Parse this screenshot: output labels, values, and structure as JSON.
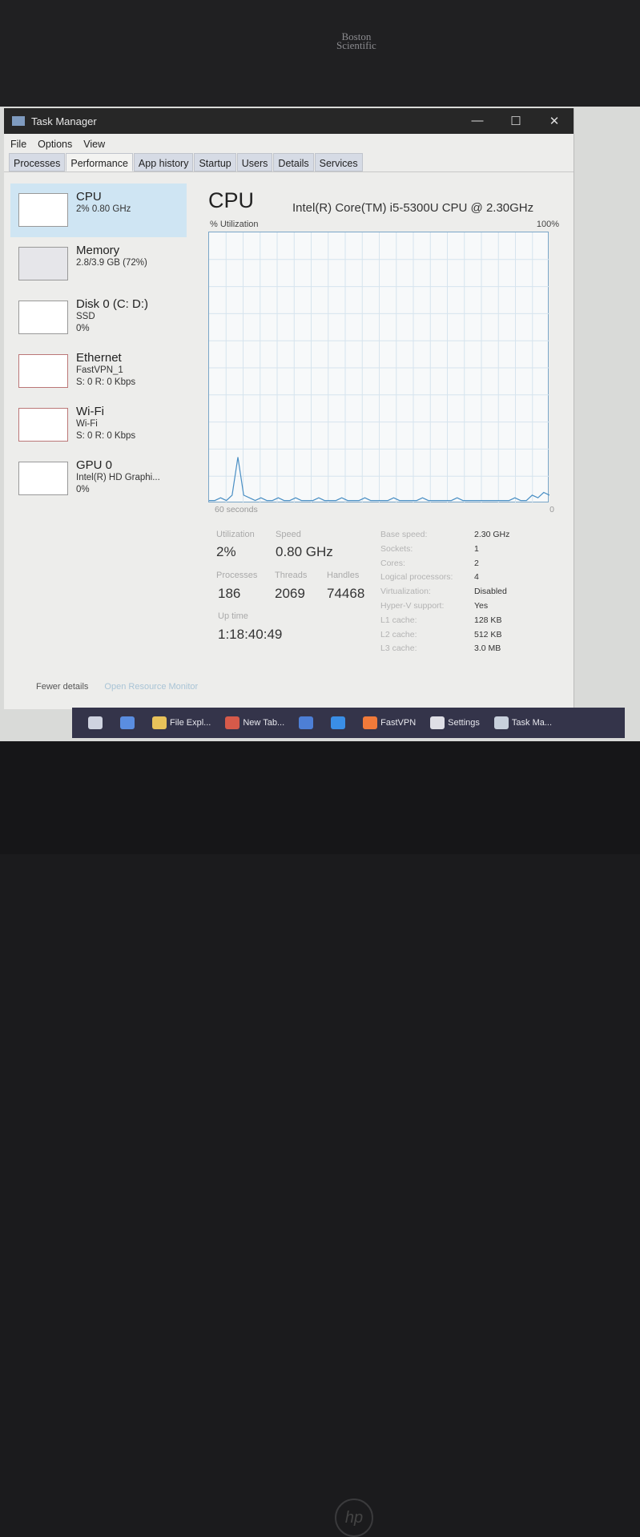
{
  "bezel": {
    "brand": "Boston Scientific",
    "logo": "hp"
  },
  "window": {
    "title": "Task Manager",
    "controls": [
      "minimize",
      "maximize",
      "close"
    ]
  },
  "menu": [
    "File",
    "Options",
    "View"
  ],
  "tabs": [
    "Processes",
    "Performance",
    "App history",
    "Startup",
    "Users",
    "Details",
    "Services"
  ],
  "active_tab": "Performance",
  "sidebar": [
    {
      "name": "CPU",
      "l1": "2% 0.80 GHz",
      "l2": "",
      "selected": true
    },
    {
      "name": "Memory",
      "l1": "2.8/3.9 GB (72%)",
      "l2": ""
    },
    {
      "name": "Disk 0 (C: D:)",
      "l1": "SSD",
      "l2": "0%"
    },
    {
      "name": "Ethernet",
      "l1": "FastVPN_1",
      "l2": "S: 0 R: 0 Kbps"
    },
    {
      "name": "Wi-Fi",
      "l1": "Wi-Fi",
      "l2": "S: 0 R: 0 Kbps"
    },
    {
      "name": "GPU 0",
      "l1": "Intel(R) HD Graphi...",
      "l2": "0%"
    }
  ],
  "main": {
    "title": "CPU",
    "model": "Intel(R) Core(TM) i5-5300U CPU @ 2.30GHz",
    "y_label": "% Utilization",
    "y_max": "100%",
    "x_label": "60 seconds",
    "y_min": "0",
    "utilization_samples": [
      1,
      1,
      2,
      1,
      3,
      17,
      3,
      2,
      1,
      2,
      1,
      1,
      2,
      1,
      1,
      2,
      1,
      1,
      1,
      2,
      1,
      1,
      1,
      2,
      1,
      1,
      1,
      2,
      1,
      1,
      1,
      1,
      2,
      1,
      1,
      1,
      1,
      2,
      1,
      1,
      1,
      1,
      1,
      2,
      1,
      1,
      1,
      1,
      1,
      1,
      1,
      1,
      1,
      2,
      1,
      1,
      3,
      2,
      4,
      3
    ],
    "stats": {
      "utilization_label": "Utilization",
      "utilization": "2%",
      "speed_label": "Speed",
      "speed": "0.80 GHz",
      "processes_label": "Processes",
      "processes": "186",
      "threads_label": "Threads",
      "threads": "2069",
      "handles_label": "Handles",
      "handles": "74468",
      "uptime_label": "Up time",
      "uptime": "1:18:40:49"
    },
    "specs": [
      {
        "k": "Base speed:",
        "v": "2.30 GHz"
      },
      {
        "k": "Sockets:",
        "v": "1"
      },
      {
        "k": "Cores:",
        "v": "2"
      },
      {
        "k": "Logical processors:",
        "v": "4"
      },
      {
        "k": "Virtualization:",
        "v": "Disabled"
      },
      {
        "k": "Hyper-V support:",
        "v": "Yes"
      },
      {
        "k": "L1 cache:",
        "v": "128 KB"
      },
      {
        "k": "L2 cache:",
        "v": "512 KB"
      },
      {
        "k": "L3 cache:",
        "v": "3.0 MB"
      }
    ]
  },
  "footer": {
    "fewer": "Fewer details",
    "monitor": "Open Resource Monitor"
  },
  "taskbar": [
    {
      "label": "",
      "icon": "task-view",
      "color": "#cfd3e0"
    },
    {
      "label": "",
      "icon": "copilot",
      "color": "#5a8de0"
    },
    {
      "label": "File Expl...",
      "icon": "folder",
      "color": "#e8c25a"
    },
    {
      "label": "New Tab...",
      "icon": "chrome",
      "color": "#d65a4a"
    },
    {
      "label": "",
      "icon": "app",
      "color": "#4d7fd6"
    },
    {
      "label": "",
      "icon": "zoom",
      "color": "#3a8ee6"
    },
    {
      "label": "FastVPN",
      "icon": "fastvpn",
      "color": "#f07a3a"
    },
    {
      "label": "Settings",
      "icon": "gear",
      "color": "#dfdfe6"
    },
    {
      "label": "Task Ma...",
      "icon": "task-manager",
      "color": "#c8d0dc"
    }
  ],
  "colors": {
    "graph_line": "#4a8fc4",
    "grid": "#d6e4ee",
    "selected": "#cfe5f3"
  }
}
